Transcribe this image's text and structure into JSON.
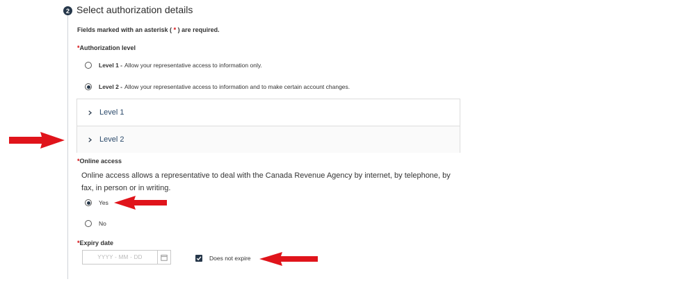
{
  "step": {
    "number": "2",
    "title": "Select authorization details"
  },
  "required_note": {
    "prefix": "Fields marked with an asterisk ( ",
    "star": "*",
    "suffix": " ) are required."
  },
  "authorization_level": {
    "star": "*",
    "label": "Authorization level",
    "options": [
      {
        "title": "Level 1 -",
        "text": "Allow your representative access to information only.",
        "selected": false
      },
      {
        "title": "Level 2 -",
        "text": "Allow your representative access to information and to make certain account changes.",
        "selected": true
      }
    ]
  },
  "accordion": {
    "items": [
      {
        "label": "Level 1"
      },
      {
        "label": "Level 2"
      }
    ]
  },
  "online_access": {
    "star": "*",
    "label": "Online access",
    "description": "Online access allows a representative to deal with the Canada Revenue Agency by internet, by telephone, by fax, in person or in writing.",
    "options": [
      {
        "label": "Yes",
        "selected": true
      },
      {
        "label": "No",
        "selected": false
      }
    ]
  },
  "expiry_date": {
    "star": "*",
    "label": "Expiry date",
    "placeholder": "YYYY  -  MM  -  DD",
    "does_not_expire_label": "Does not expire",
    "does_not_expire_checked": true
  },
  "colors": {
    "accent": "#26374a",
    "required": "#d3080c",
    "annotation_arrow": "#e0141b",
    "link": "#2b4a6b"
  },
  "icons": {
    "accordion_toggle": "chevron-right-icon",
    "calendar": "calendar-icon",
    "annotation": "red-arrow-icon"
  }
}
